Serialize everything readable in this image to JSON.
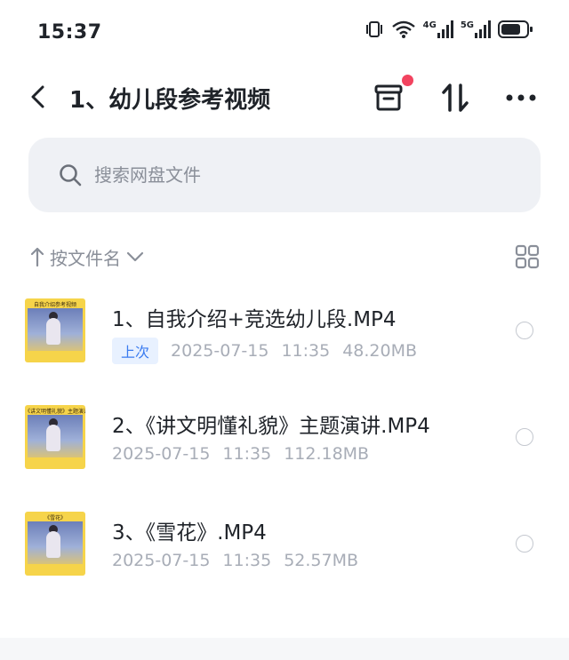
{
  "status_bar": {
    "time": "15:37",
    "network_4g": "4G",
    "network_5g": "5G",
    "icons": [
      "vibrate-icon",
      "wifi-icon",
      "signal-4g-icon",
      "signal-5g-icon",
      "battery-icon"
    ]
  },
  "header": {
    "title": "1、幼儿段参考视频",
    "back_icon": "chevron-left-icon",
    "actions": [
      "archive-icon",
      "sort-arrows-icon",
      "more-icon"
    ],
    "notification_color": "#f2435f"
  },
  "search": {
    "placeholder": "搜索网盘文件"
  },
  "sort": {
    "label": "按文件名"
  },
  "files": [
    {
      "name": "1、自我介绍+竞选幼儿段.MP4",
      "tag": "上次",
      "date": "2025-07-15",
      "time": "11:35",
      "size": "48.20MB",
      "thumb_caption": "自我介绍参考视频"
    },
    {
      "name": "2、《讲文明懂礼貌》主题演讲.MP4",
      "tag": "",
      "date": "2025-07-15",
      "time": "11:35",
      "size": "112.18MB",
      "thumb_caption": "《讲文明懂礼貌》主题演讲"
    },
    {
      "name": "3、《雪花》.MP4",
      "tag": "",
      "date": "2025-07-15",
      "time": "11:35",
      "size": "52.57MB",
      "thumb_caption": "《雪花》"
    }
  ],
  "colors": {
    "accent": "#3a7bf0",
    "text_primary": "#1f2329",
    "text_secondary": "#a8adb7",
    "search_bg": "#eff1f5"
  }
}
